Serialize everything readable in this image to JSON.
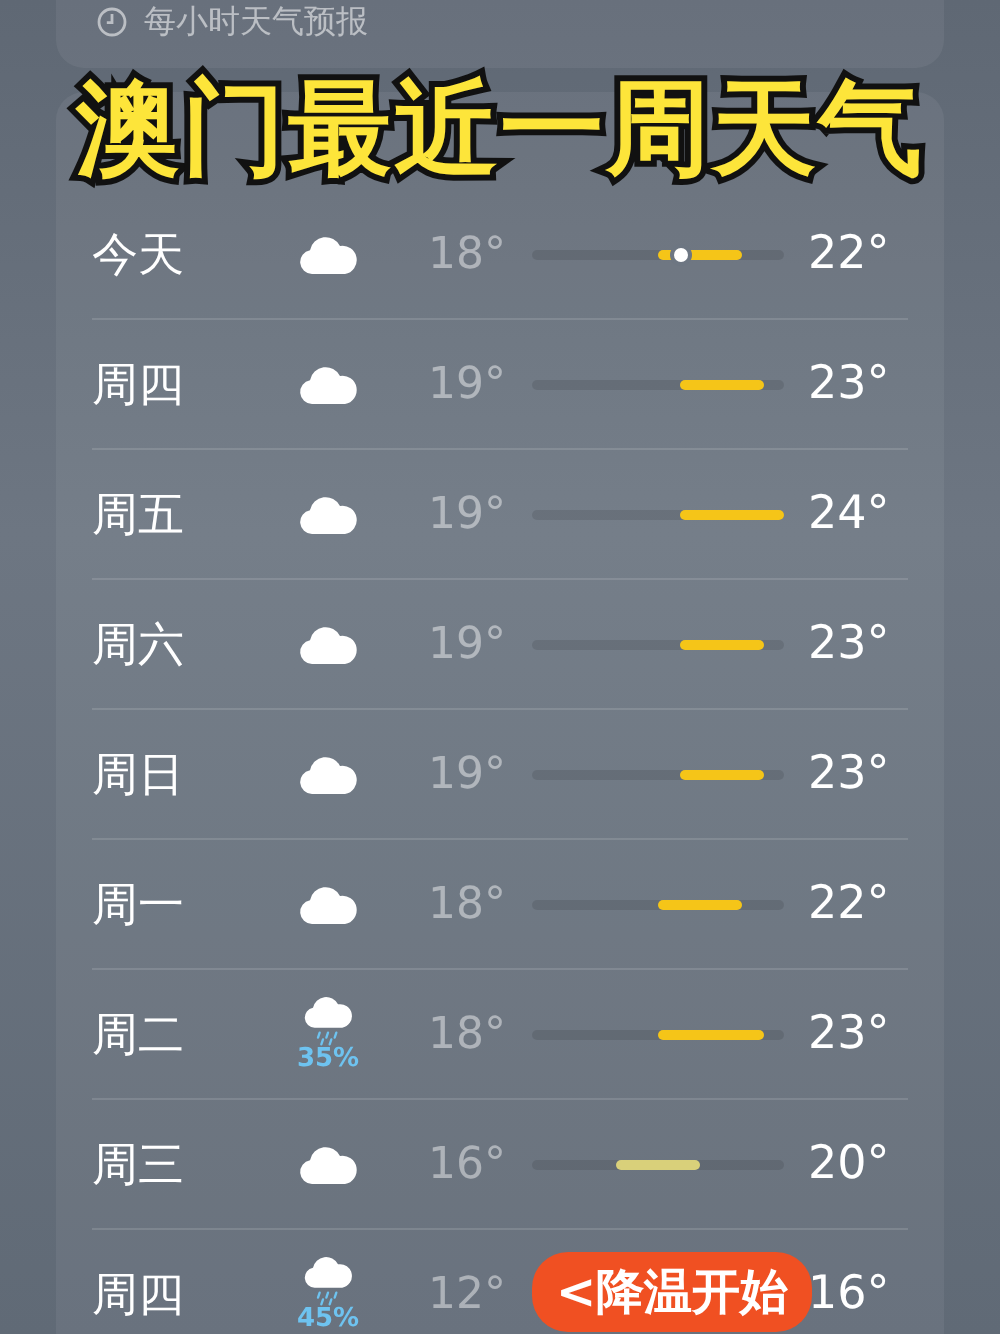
{
  "hourly_card": {
    "title": "每小时天气预报"
  },
  "overlay_title": "澳门最近一周天气",
  "forecast": [
    {
      "day": "今天",
      "kind": "cloud",
      "low": "18°",
      "high": "22°",
      "color": "#f5c518",
      "now_marker": true
    },
    {
      "day": "周四",
      "kind": "cloud",
      "low": "19°",
      "high": "23°",
      "color": "#f5c518",
      "now_marker": false
    },
    {
      "day": "周五",
      "kind": "cloud",
      "low": "19°",
      "high": "24°",
      "color": "#f5c518",
      "now_marker": false
    },
    {
      "day": "周六",
      "kind": "cloud",
      "low": "19°",
      "high": "23°",
      "color": "#f5c518",
      "now_marker": false
    },
    {
      "day": "周日",
      "kind": "cloud",
      "low": "19°",
      "high": "23°",
      "color": "#f5c518",
      "now_marker": false
    },
    {
      "day": "周一",
      "kind": "cloud",
      "low": "18°",
      "high": "22°",
      "color": "#f5c518",
      "now_marker": false
    },
    {
      "day": "周二",
      "kind": "rain",
      "precipitation": "35%",
      "low": "18°",
      "high": "23°",
      "color": "#f5c518",
      "now_marker": false
    },
    {
      "day": "周三",
      "kind": "cloud",
      "low": "16°",
      "high": "20°",
      "color": "#d9d07a",
      "now_marker": false
    },
    {
      "day": "周四",
      "kind": "rain",
      "precipitation": "45%",
      "low": "12°",
      "high": "16°",
      "now_marker": false
    }
  ],
  "sticker": "<降温开始"
}
